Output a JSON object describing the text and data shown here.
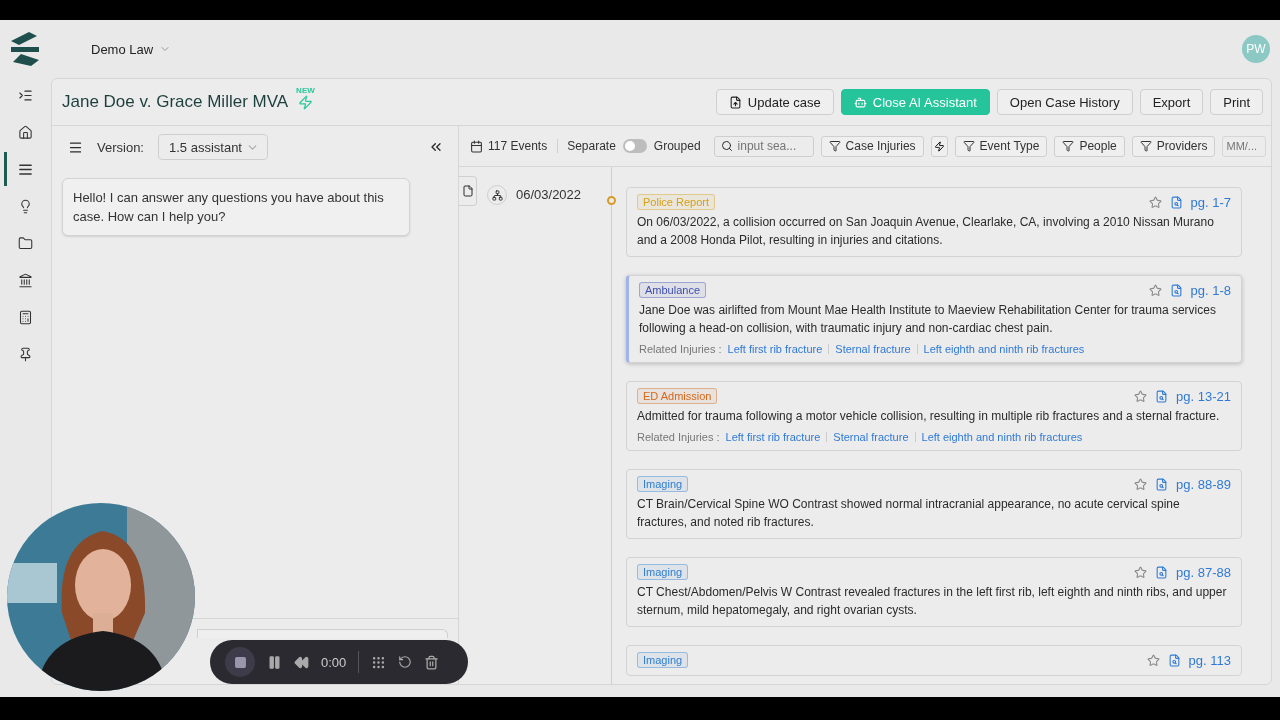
{
  "workspace": {
    "name": "Demo Law",
    "avatar": "PW"
  },
  "nav": [
    {
      "kind": "collapse",
      "selected": false
    },
    {
      "kind": "home",
      "selected": false
    },
    {
      "kind": "list",
      "selected": true
    },
    {
      "kind": "bulb",
      "selected": false
    },
    {
      "kind": "folder",
      "selected": false
    },
    {
      "kind": "bank",
      "selected": false
    },
    {
      "kind": "table",
      "selected": false
    },
    {
      "kind": "pin",
      "selected": false
    }
  ],
  "case": {
    "title": "Jane Doe v. Grace Miller MVA",
    "badge": "NEW"
  },
  "actions": [
    {
      "kind": "file",
      "label": "Update case",
      "primary": false
    },
    {
      "kind": "bot",
      "label": "Close AI Assistant",
      "primary": true
    },
    {
      "kind": "none",
      "label": "Open Case History",
      "primary": false
    },
    {
      "kind": "none",
      "label": "Export",
      "primary": false
    },
    {
      "kind": "none",
      "label": "Print",
      "primary": false
    }
  ],
  "assistant": {
    "version_label": "Version:",
    "version": "1.5 assistant",
    "messages": [
      "Hello! I can answer any questions you have about this case. How can I help you?"
    ]
  },
  "toolbar": {
    "events": "117 Events",
    "toggle_left": "Separate",
    "toggle_right": "Grouped",
    "toggle_on": false,
    "search_placeholder": "input sea...",
    "filters": [
      "Case Injuries",
      "Event Type",
      "People",
      "Providers"
    ],
    "date_placeholder": "MM/..."
  },
  "timeline": {
    "date": "06/03/2022",
    "events": [
      {
        "tag": "Police Report",
        "color": "#d4a017",
        "pages": "pg. 1-7",
        "selected": false,
        "text": "On 06/03/2022, a collision occurred on San Joaquin Avenue, Clearlake, CA, involving a 2010 Nissan Murano and a 2008 Honda Pilot, resulting in injuries and citations."
      },
      {
        "tag": "Ambulance",
        "color": "#3f4fb0",
        "pages": "pg. 1-8",
        "selected": true,
        "text": "Jane Doe was airlifted from Mount Mae Health Institute to Maeview Rehabilitation Center for trauma services following a head-on collision, with traumatic injury and non-cardiac chest pain.",
        "related_label": "Related Injuries :",
        "injuries": [
          "Left first rib fracture",
          "Sternal fracture",
          "Left eighth and ninth rib fractures"
        ]
      },
      {
        "tag": "ED Admission",
        "color": "#d2691e",
        "pages": "pg. 13-21",
        "selected": false,
        "text": "Admitted for trauma following a motor vehicle collision, resulting in multiple rib fractures and a sternal fracture.",
        "related_label": "Related Injuries :",
        "injuries": [
          "Left first rib fracture",
          "Sternal fracture",
          "Left eighth and ninth rib fractures"
        ]
      },
      {
        "tag": "Imaging",
        "color": "#2f7fd0",
        "pages": "pg. 88-89",
        "selected": false,
        "text": "CT Brain/Cervical Spine WO Contrast showed normal intracranial appearance, no acute cervical spine fractures, and noted rib fractures."
      },
      {
        "tag": "Imaging",
        "color": "#2f7fd0",
        "pages": "pg. 87-88",
        "selected": false,
        "text": "CT Chest/Abdomen/Pelvis W Contrast revealed fractures in the left first rib, left eighth and ninth ribs, and upper sternum, mild hepatomegaly, and right ovarian cysts."
      },
      {
        "tag": "Imaging",
        "color": "#2f7fd0",
        "pages": "pg. 113",
        "selected": false
      }
    ]
  },
  "recorder": {
    "time": "0:00"
  }
}
